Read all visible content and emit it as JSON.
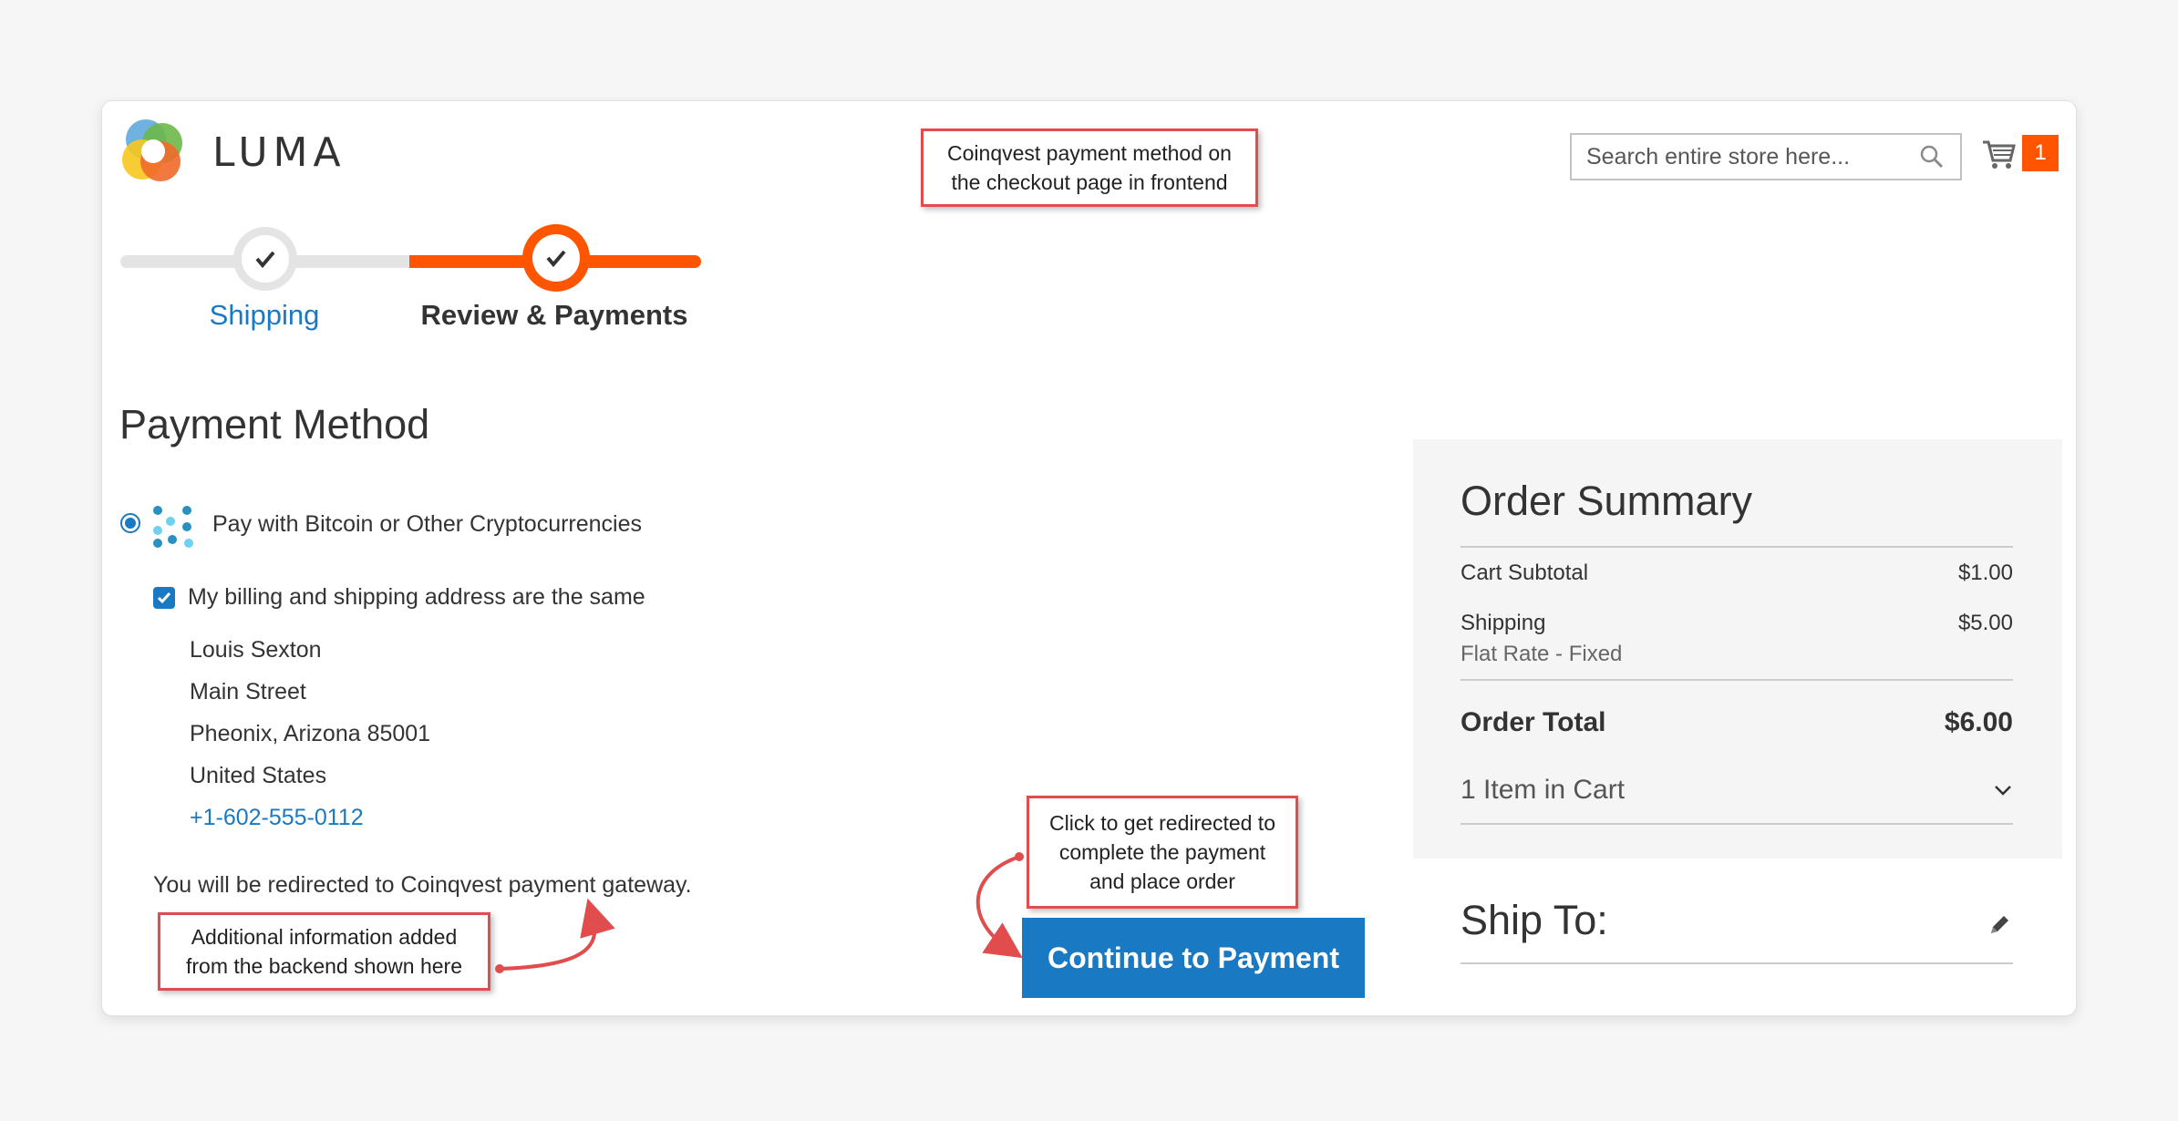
{
  "header": {
    "logo_text": "LUMA",
    "search_placeholder": "Search entire store here...",
    "cart_count": "1"
  },
  "progress": {
    "steps": [
      {
        "label": "Shipping",
        "state": "complete"
      },
      {
        "label": "Review & Payments",
        "state": "active"
      }
    ]
  },
  "payment": {
    "title": "Payment Method",
    "method_label": "Pay with Bitcoin or Other Cryptocurrencies",
    "same_address_label": "My billing and shipping address are the same",
    "same_address_checked": true,
    "address": {
      "name": "Louis Sexton",
      "street": "Main Street",
      "city_line": "Pheonix, Arizona 85001",
      "country": "United States",
      "phone": "+1-602-555-0112"
    },
    "redirect_note": "You will be redirected to Coinqvest payment gateway.",
    "continue_label": "Continue to Payment"
  },
  "summary": {
    "title": "Order Summary",
    "subtotal_label": "Cart Subtotal",
    "subtotal_value": "$1.00",
    "shipping_label": "Shipping",
    "shipping_value": "$5.00",
    "shipping_method": "Flat Rate - Fixed",
    "total_label": "Order Total",
    "total_value": "$6.00",
    "items_label": "1 Item in Cart",
    "ship_to_title": "Ship To:"
  },
  "annotations": {
    "checkout_note": "Coinqvest payment method on the checkout page in frontend",
    "redirect_note": "Click to get redirected to complete the payment and place order",
    "backend_note": "Additional information added from the backend shown here"
  },
  "colors": {
    "accent_blue": "#1979c3",
    "accent_orange": "#ff5501",
    "callout_red": "#e14c4c",
    "summary_bg": "#f5f5f5"
  }
}
